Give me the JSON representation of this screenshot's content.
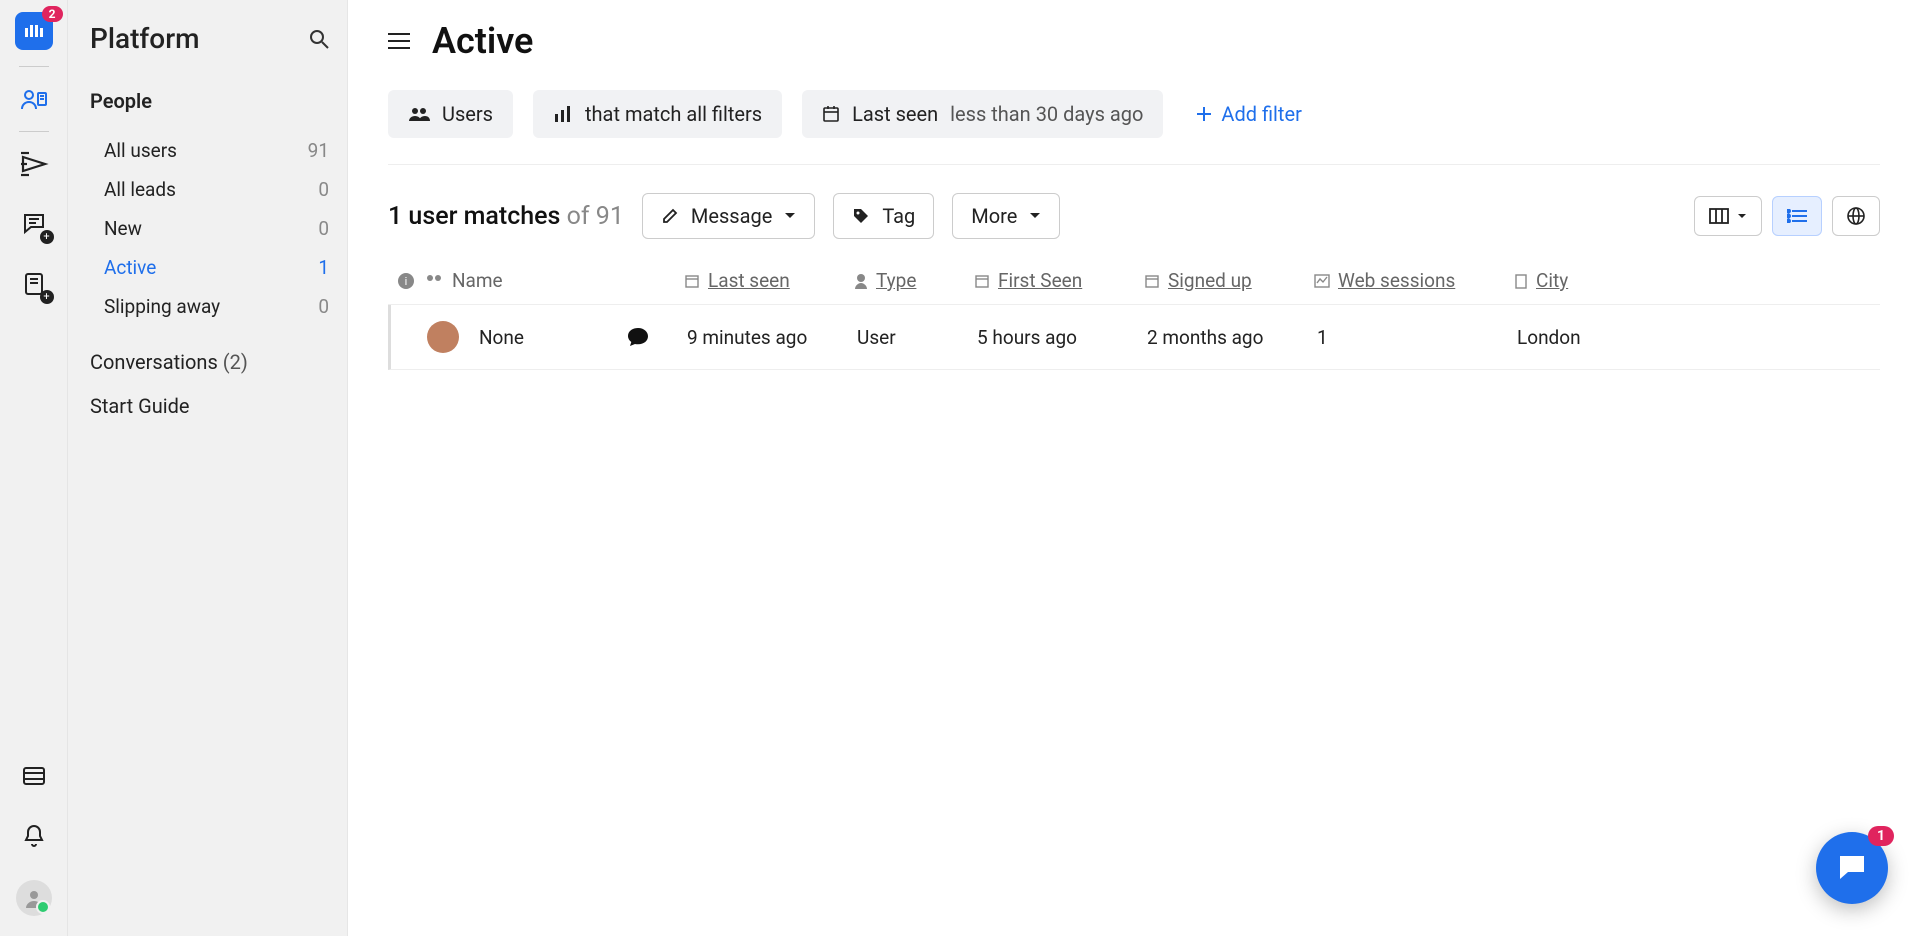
{
  "rail": {
    "logo_badge": "2"
  },
  "sidebar": {
    "title": "Platform",
    "sec_people": "People",
    "items": [
      {
        "label": "All users",
        "count": "91"
      },
      {
        "label": "All leads",
        "count": "0"
      },
      {
        "label": "New",
        "count": "0"
      },
      {
        "label": "Active",
        "count": "1"
      },
      {
        "label": "Slipping away",
        "count": "0"
      }
    ],
    "conversations_label": "Conversations",
    "conversations_count": "(2)",
    "start_guide": "Start Guide"
  },
  "header": {
    "title": "Active"
  },
  "filters": {
    "users": "Users",
    "match": "that match all filters",
    "lastseen_label": "Last seen",
    "lastseen_value": "less than 30 days ago",
    "add": "Add filter"
  },
  "toolbar": {
    "matches_count": "1 user matches",
    "matches_of": "of 91",
    "message": "Message",
    "tag": "Tag",
    "more": "More"
  },
  "columns": {
    "name": "Name",
    "last_seen": "Last seen",
    "type": "Type",
    "first_seen": "First Seen",
    "signed_up": "Signed up",
    "web_sessions": "Web sessions",
    "city": "City"
  },
  "rows": [
    {
      "name": "None",
      "last_seen": "9 minutes ago",
      "type": "User",
      "first_seen": "5 hours ago",
      "signed_up": "2 months ago",
      "web_sessions": "1",
      "city": "London"
    }
  ],
  "chat_fab_badge": "1"
}
